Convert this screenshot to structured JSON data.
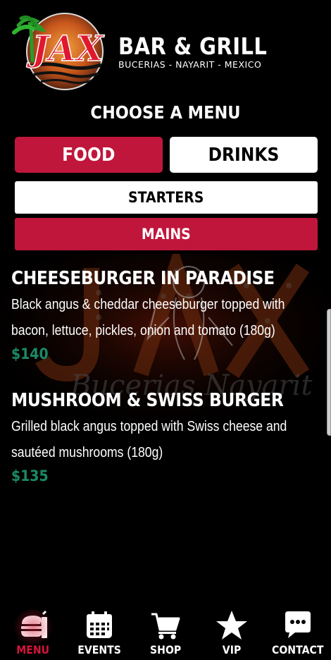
{
  "header": {
    "logo_text": "JAX",
    "brand_title": "BAR & GRILL",
    "brand_subtitle": "BUCERIAS - NAYARIT - MEXICO"
  },
  "menu_chooser": {
    "heading": "CHOOSE A MENU",
    "food_label": "FOOD",
    "drinks_label": "DRINKS",
    "active_menu": "FOOD",
    "starters_label": "STARTERS",
    "mains_label": "MAINS",
    "active_section": "MAINS"
  },
  "items": [
    {
      "title": "CHEESEBURGER IN PARADISE",
      "description": "Black angus & cheddar cheeseburger topped with bacon, lettuce, pickles, onion and tomato (180g)",
      "price": "$140"
    },
    {
      "title": "MUSHROOM & SWISS BURGER",
      "description": "Grilled black angus topped with Swiss cheese and sautéed mushrooms (180g)",
      "price": "$135"
    }
  ],
  "nav": {
    "items": [
      {
        "label": "MENU",
        "icon": "burger-icon",
        "active": true
      },
      {
        "label": "EVENTS",
        "icon": "calendar-icon",
        "active": false
      },
      {
        "label": "SHOP",
        "icon": "cart-icon",
        "active": false
      },
      {
        "label": "VIP",
        "icon": "star-icon",
        "active": false
      },
      {
        "label": "CONTACT",
        "icon": "chat-icon",
        "active": false
      }
    ]
  },
  "colors": {
    "accent": "#c0163c",
    "price": "#1b8a66",
    "background": "#000000"
  }
}
